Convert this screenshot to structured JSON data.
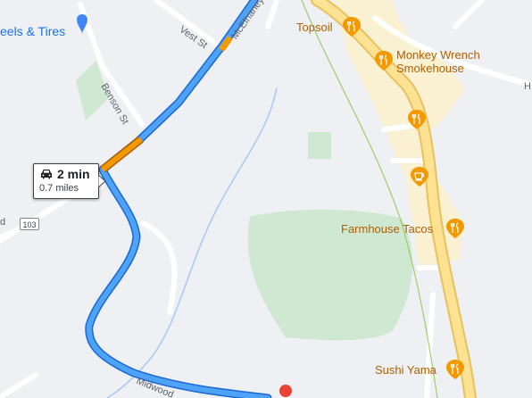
{
  "map": {
    "streets": {
      "vest_st": "Vest St",
      "mcelhaney": "McElhaney",
      "benson_st": "Benson St",
      "midwood": "Midwood",
      "left_edge": "d",
      "right_edge": "H"
    },
    "route_shield": "103",
    "business": {
      "name": "eels & Tires"
    },
    "pois": [
      {
        "name": "Topsoil",
        "icon": "restaurant-icon"
      },
      {
        "name": "Monkey Wrench",
        "name2": "Smokehouse",
        "icon": "restaurant-icon"
      },
      {
        "name": "Farmhouse Tacos",
        "icon": "restaurant-icon"
      },
      {
        "name": "Sushi Yama",
        "icon": "restaurant-icon"
      },
      {
        "name": "",
        "icon": "restaurant-icon"
      },
      {
        "name": "",
        "icon": "cafe-icon"
      }
    ],
    "route": {
      "time": "2 min",
      "distance": "0.7 miles",
      "mode_icon": "car-icon"
    },
    "colors": {
      "route_blue": "#1a73e8",
      "traffic_orange": "#f29900",
      "highway_yellow": "#fde293",
      "park_green": "#c8e6c9",
      "destination_red": "#ea4335"
    }
  }
}
